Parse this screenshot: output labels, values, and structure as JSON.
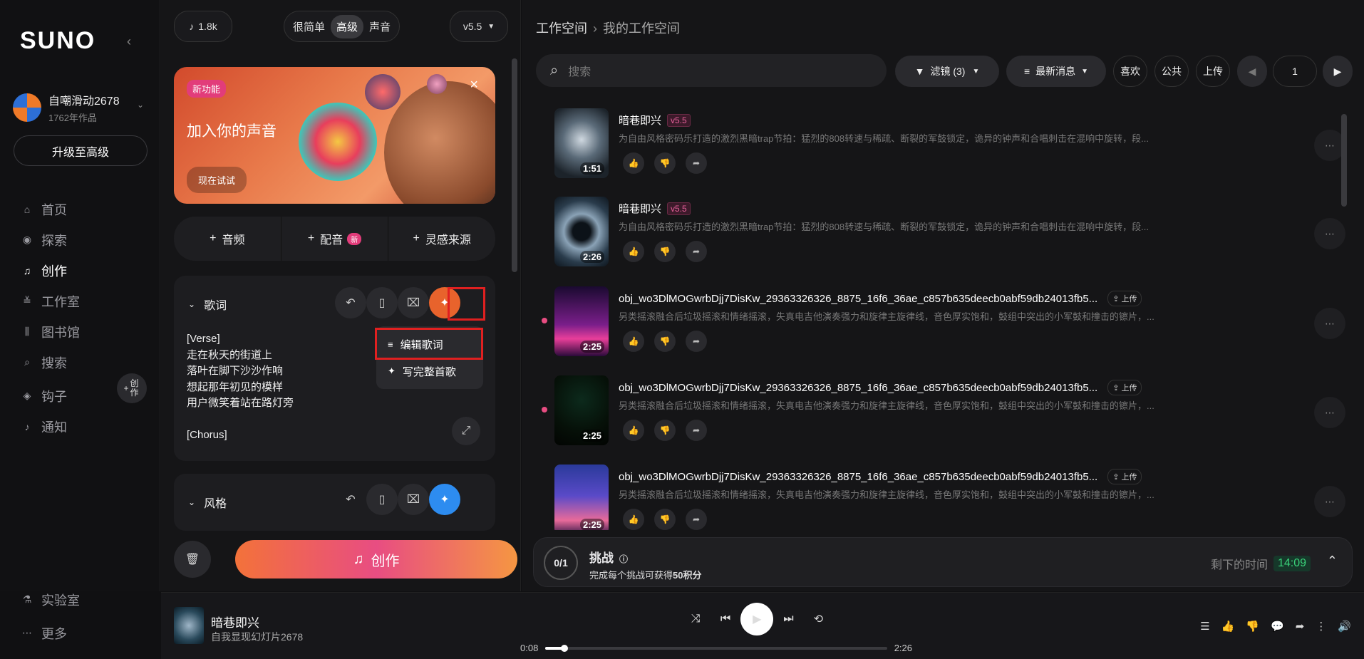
{
  "sidebar": {
    "logo": "SUNO",
    "user": {
      "name": "自嘲滑动2678",
      "count": "1762年作品"
    },
    "upgrade": "升级至高级",
    "nav": [
      {
        "label": "首页",
        "icon": "home-icon"
      },
      {
        "label": "探索",
        "icon": "compass-icon"
      },
      {
        "label": "创作",
        "icon": "music-create-icon",
        "active": true
      },
      {
        "label": "工作室",
        "icon": "studio-icon"
      },
      {
        "label": "图书馆",
        "icon": "library-icon"
      },
      {
        "label": "搜索",
        "icon": "search-icon"
      },
      {
        "label": "钩子",
        "icon": "hook-icon"
      },
      {
        "label": "通知",
        "icon": "bell-icon"
      }
    ],
    "create_fab": "创作",
    "bottom": [
      {
        "label": "实验室",
        "icon": "flask-icon"
      },
      {
        "label": "更多",
        "icon": "dots-icon"
      }
    ]
  },
  "create_panel": {
    "credits": "1.8k",
    "modes": [
      "很简单",
      "高级",
      "声音"
    ],
    "selected_mode": "高级",
    "version": "v5.5",
    "banner": {
      "badge": "新功能",
      "title": "加入你的声音",
      "cta": "现在试试"
    },
    "add_row": [
      {
        "label": "音频"
      },
      {
        "label": "配音",
        "tag": "新"
      },
      {
        "label": "灵感来源"
      }
    ],
    "lyrics_card": {
      "title": "歌词",
      "lines": [
        "[Verse]",
        "走在秋天的街道上",
        "落叶在脚下沙沙作响",
        "想起那年初见的模样",
        "用户微笑着站在路灯旁",
        "",
        "[Chorus]"
      ]
    },
    "lyrics_menu": [
      "编辑歌词",
      "写完整首歌"
    ],
    "style_card": {
      "title": "风格"
    },
    "create_label": "创作"
  },
  "workspace": {
    "breadcrumb": [
      "工作空间",
      "我的工作空间"
    ],
    "search_placeholder": "搜索",
    "filter": "滤镜 (3)",
    "sort": "最新消息",
    "btn_like": "喜欢",
    "btn_public": "公共",
    "btn_upload": "上传",
    "page": "1",
    "songs": [
      {
        "title": "暗巷即兴",
        "version": "v5.5",
        "desc": "为自由风格密码乐打造的激烈黑暗trap节拍：猛烈的808转速与稀疏、断裂的军鼓锁定，诡异的钟声和合唱刺击在混响中旋转，段...",
        "duration": "1:51"
      },
      {
        "title": "暗巷即兴",
        "version": "v5.5",
        "desc": "为自由风格密码乐打造的激烈黑暗trap节拍：猛烈的808转速与稀疏、断裂的军鼓锁定，诡异的钟声和合唱刺击在混响中旋转，段...",
        "duration": "2:26"
      },
      {
        "title": "obj_wo3DlMOGwrbDjj7DisKw_29363326326_8875_16f6_36ae_c857b635deecb0abf59db24013fb5...",
        "upload": "上传",
        "desc": "另类摇滚融合后垃圾摇滚和情绪摇滚，失真电吉他演奏强力和旋律主旋律线，音色厚实饱和，鼓组中突出的小军鼓和撞击的镲片，...",
        "duration": "2:25"
      },
      {
        "title": "obj_wo3DlMOGwrbDjj7DisKw_29363326326_8875_16f6_36ae_c857b635deecb0abf59db24013fb5...",
        "upload": "上传",
        "desc": "另类摇滚融合后垃圾摇滚和情绪摇滚，失真电吉他演奏强力和旋律主旋律线，音色厚实饱和，鼓组中突出的小军鼓和撞击的镲片，...",
        "duration": "2:25"
      },
      {
        "title": "obj_wo3DlMOGwrbDjj7DisKw_29363326326_8875_16f6_36ae_c857b635deecb0abf59db24013fb5...",
        "upload": "上传",
        "desc": "另类摇滚融合后垃圾摇滚和情绪摇滚，失真电吉他演奏强力和旋律主旋律线，音色厚实饱和，鼓组中突出的小军鼓和撞击的镲片，...",
        "duration": "2:25"
      }
    ],
    "challenge": {
      "count": "0/1",
      "title": "挑战",
      "sub_prefix": "完成每个挑战可获得",
      "sub_bold": "50积分",
      "time_label": "剩下的时间",
      "time": "14:09"
    }
  },
  "player": {
    "title": "暗巷即兴",
    "artist": "自我显现幻灯片2678",
    "current": "0:08",
    "total": "2:26",
    "progress": 0.055
  }
}
